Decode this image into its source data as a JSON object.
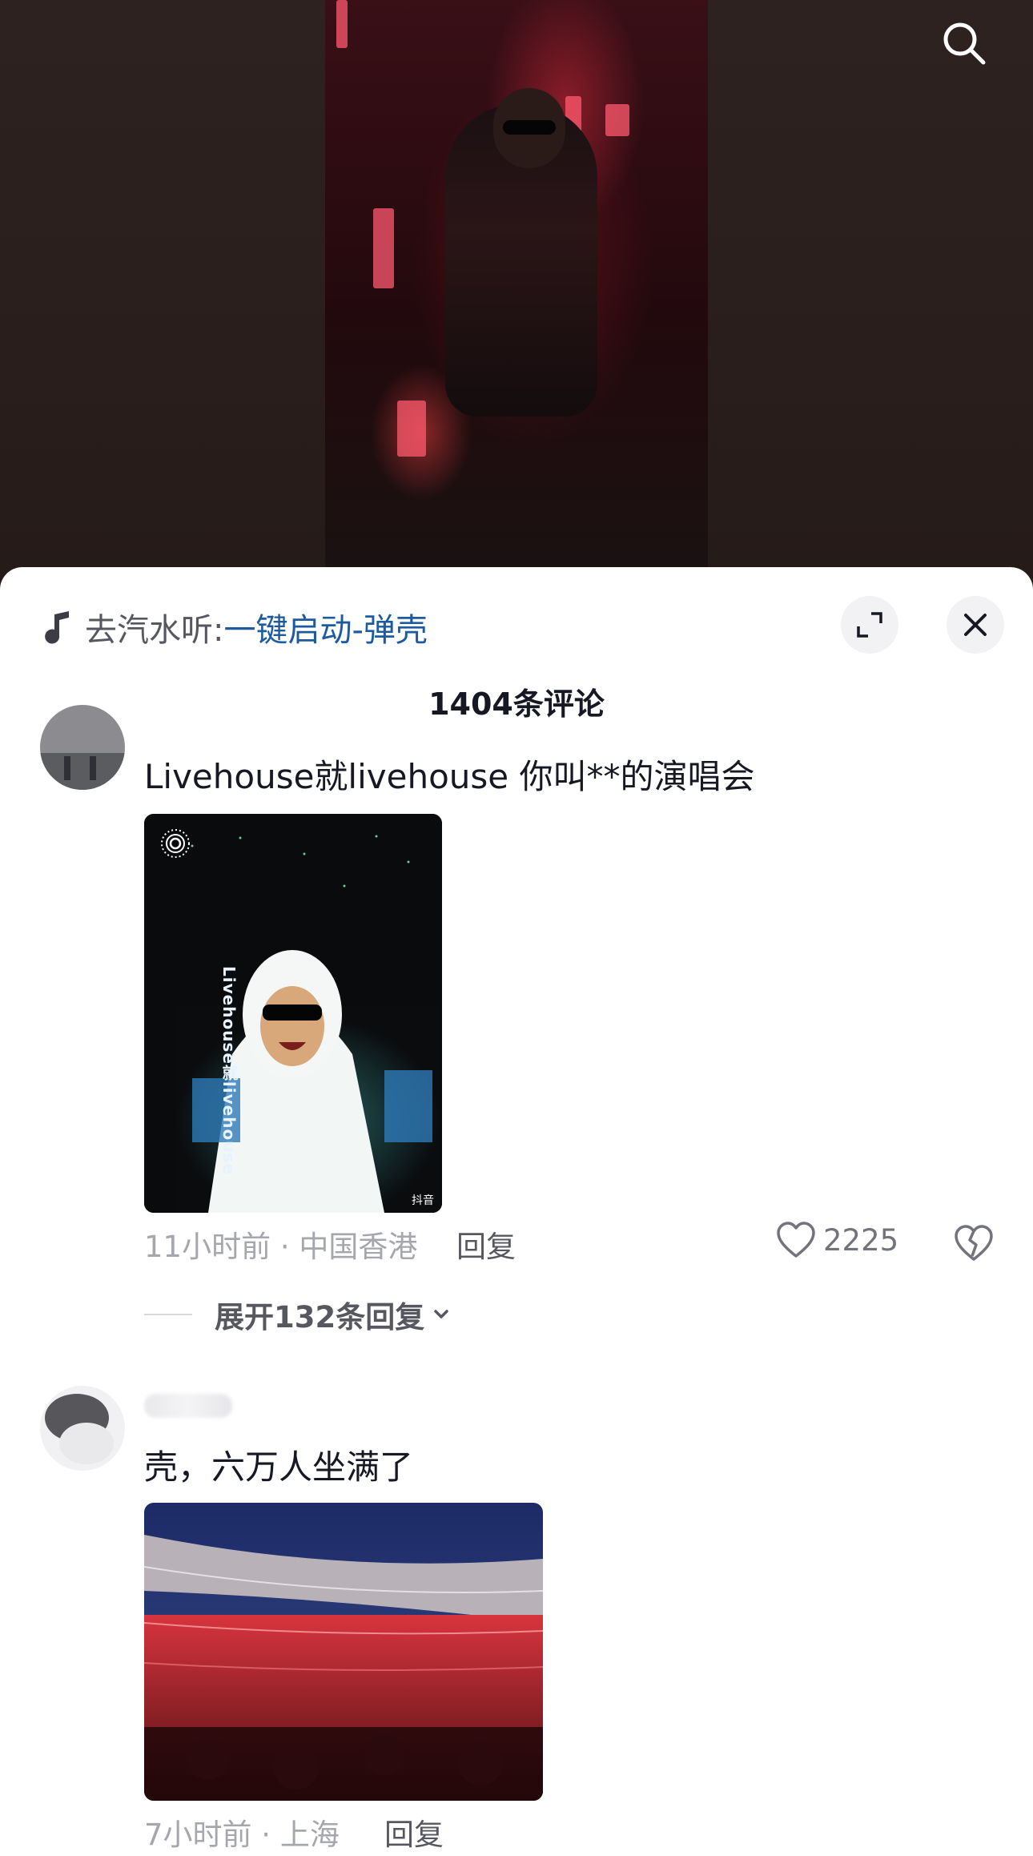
{
  "music": {
    "prefix": "去汽水听:",
    "title": "一键启动-弹壳"
  },
  "sheet": {
    "title": "1404条评论"
  },
  "comments": [
    {
      "text": "Livehouse就livehouse 你叫**的演唱会",
      "image_caption": "Livehouse就livehouse",
      "watermark": "抖音",
      "time_location": "11小时前 · 中国香港",
      "reply": "回复",
      "likes": "2225",
      "expand": "展开132条回复"
    },
    {
      "text": "壳，六万人坐满了",
      "time_location": "7小时前 · 上海",
      "reply": "回复"
    }
  ],
  "icons": {
    "search": "search-icon",
    "music": "music-note-icon",
    "expand": "expand-icon",
    "close": "close-icon",
    "like": "heart-icon",
    "dislike": "broken-heart-icon",
    "chevron": "chevron-down-icon"
  },
  "colors": {
    "link": "#1e5a9e",
    "meta": "#a5a7ad",
    "sheet_bg": "#ffffff"
  }
}
